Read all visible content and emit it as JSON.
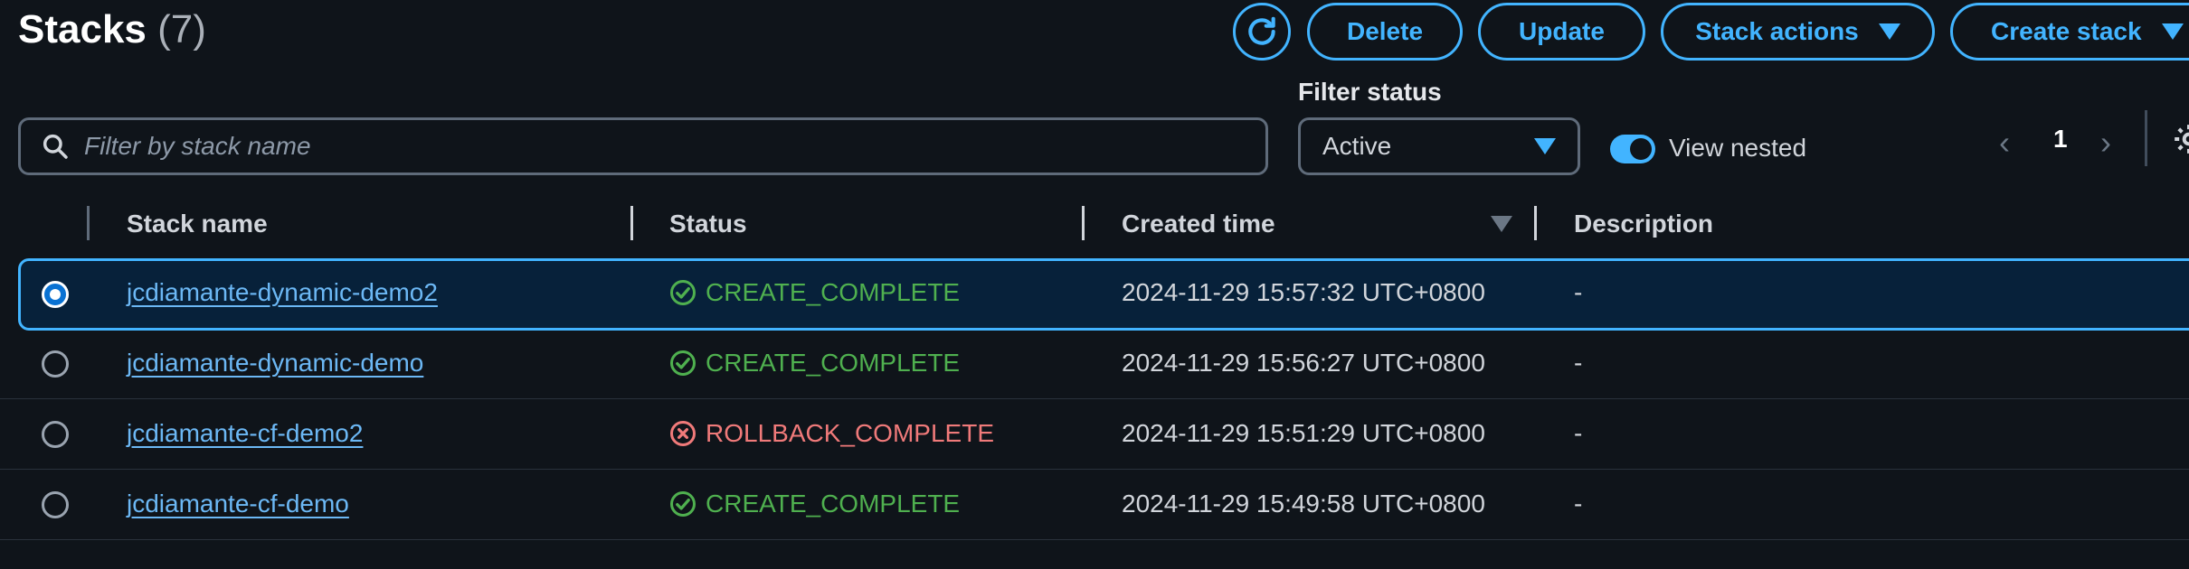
{
  "header": {
    "title": "Stacks",
    "count": "(7)",
    "buttons": {
      "delete": "Delete",
      "update": "Update",
      "stack_actions": "Stack actions",
      "create_stack": "Create stack"
    }
  },
  "filters": {
    "search_placeholder": "Filter by stack name",
    "status_label": "Filter status",
    "status_value": "Active",
    "view_nested_label": "View nested",
    "view_nested_on": true
  },
  "pagination": {
    "current_page": "1",
    "prev": "‹",
    "next": "›"
  },
  "table": {
    "columns": {
      "name": "Stack name",
      "status": "Status",
      "created": "Created time",
      "description": "Description"
    },
    "rows": [
      {
        "name": "jcdiamante-dynamic-demo2",
        "status": "CREATE_COMPLETE",
        "status_type": "ok",
        "created": "2024-11-29 15:57:32 UTC+0800",
        "description": "-",
        "selected": true
      },
      {
        "name": "jcdiamante-dynamic-demo",
        "status": "CREATE_COMPLETE",
        "status_type": "ok",
        "created": "2024-11-29 15:56:27 UTC+0800",
        "description": "-",
        "selected": false
      },
      {
        "name": "jcdiamante-cf-demo2",
        "status": "ROLLBACK_COMPLETE",
        "status_type": "err",
        "created": "2024-11-29 15:51:29 UTC+0800",
        "description": "-",
        "selected": false
      },
      {
        "name": "jcdiamante-cf-demo",
        "status": "CREATE_COMPLETE",
        "status_type": "ok",
        "created": "2024-11-29 15:49:58 UTC+0800",
        "description": "-",
        "selected": false
      }
    ]
  },
  "colors": {
    "accent": "#42b4ff",
    "success": "#4fb04f",
    "error": "#f07a7a",
    "background": "#0f141a"
  }
}
